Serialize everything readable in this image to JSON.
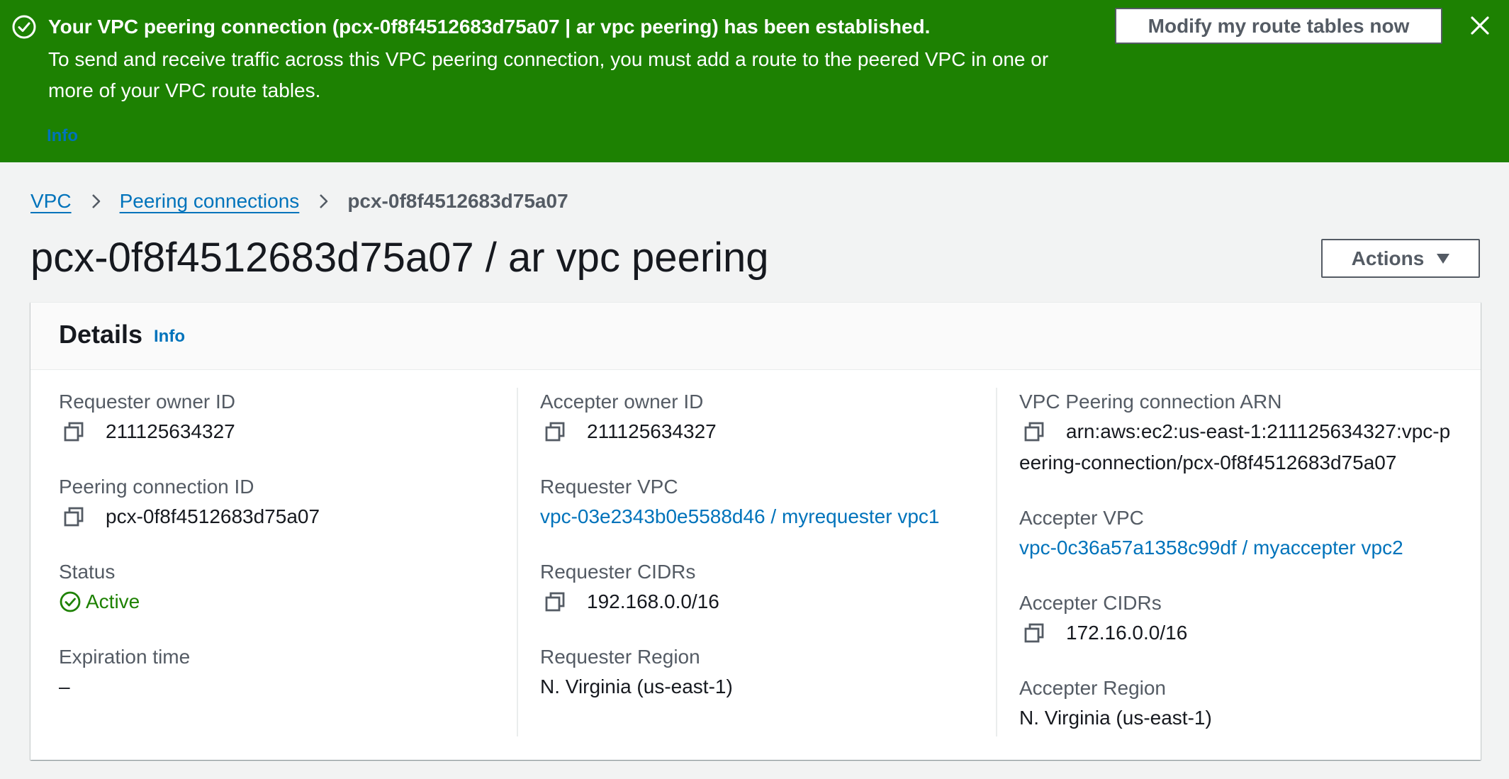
{
  "flash": {
    "title": "Your VPC peering connection (pcx-0f8f4512683d75a07 | ar vpc peering) has been established.",
    "message": "To send and receive traffic across this VPC peering connection, you must add a route to the peered VPC in one or more of your VPC route tables.",
    "info_link": "Info",
    "action_button": "Modify my route tables now",
    "close_icon": "close-icon",
    "success_icon": "success-check-icon"
  },
  "breadcrumb": {
    "items": [
      "VPC",
      "Peering connections"
    ],
    "current": "pcx-0f8f4512683d75a07"
  },
  "page": {
    "title": "pcx-0f8f4512683d75a07 / ar vpc peering",
    "actions_button": "Actions"
  },
  "details": {
    "title": "Details",
    "info_link": "Info",
    "requester_owner_id": {
      "label": "Requester owner ID",
      "value": "211125634327"
    },
    "peering_connection_id": {
      "label": "Peering connection ID",
      "value": "pcx-0f8f4512683d75a07"
    },
    "status": {
      "label": "Status",
      "value": "Active"
    },
    "expiration_time": {
      "label": "Expiration time",
      "value": "–"
    },
    "accepter_owner_id": {
      "label": "Accepter owner ID",
      "value": "211125634327"
    },
    "requester_vpc": {
      "label": "Requester VPC",
      "value": "vpc-03e2343b0e5588d46 / myrequester vpc1"
    },
    "requester_cidrs": {
      "label": "Requester CIDRs",
      "value": "192.168.0.0/16"
    },
    "requester_region": {
      "label": "Requester Region",
      "value": "N. Virginia (us-east-1)"
    },
    "peering_arn": {
      "label": "VPC Peering connection ARN",
      "value": "arn:aws:ec2:us-east-1:211125634327:vpc-peering-connection/pcx-0f8f4512683d75a07"
    },
    "accepter_vpc": {
      "label": "Accepter VPC",
      "value": "vpc-0c36a57a1358c99df / myaccepter vpc2"
    },
    "accepter_cidrs": {
      "label": "Accepter CIDRs",
      "value": "172.16.0.0/16"
    },
    "accepter_region": {
      "label": "Accepter Region",
      "value": "N. Virginia (us-east-1)"
    }
  },
  "colors": {
    "flash_background": "#1d8102",
    "link": "#0073bb",
    "status_active": "#1d8102",
    "page_background": "#f2f3f3"
  }
}
